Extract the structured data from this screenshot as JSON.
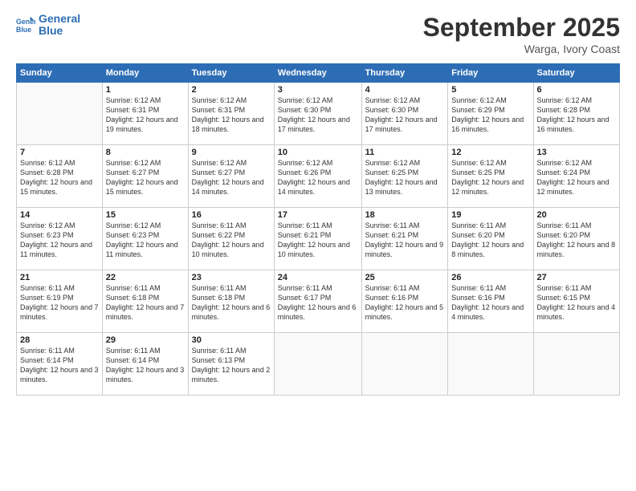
{
  "logo": {
    "line1": "General",
    "line2": "Blue"
  },
  "title": "September 2025",
  "location": "Warga, Ivory Coast",
  "days_of_week": [
    "Sunday",
    "Monday",
    "Tuesday",
    "Wednesday",
    "Thursday",
    "Friday",
    "Saturday"
  ],
  "weeks": [
    [
      {
        "day": "",
        "sunrise": "",
        "sunset": "",
        "daylight": ""
      },
      {
        "day": "1",
        "sunrise": "Sunrise: 6:12 AM",
        "sunset": "Sunset: 6:31 PM",
        "daylight": "Daylight: 12 hours and 19 minutes."
      },
      {
        "day": "2",
        "sunrise": "Sunrise: 6:12 AM",
        "sunset": "Sunset: 6:31 PM",
        "daylight": "Daylight: 12 hours and 18 minutes."
      },
      {
        "day": "3",
        "sunrise": "Sunrise: 6:12 AM",
        "sunset": "Sunset: 6:30 PM",
        "daylight": "Daylight: 12 hours and 17 minutes."
      },
      {
        "day": "4",
        "sunrise": "Sunrise: 6:12 AM",
        "sunset": "Sunset: 6:30 PM",
        "daylight": "Daylight: 12 hours and 17 minutes."
      },
      {
        "day": "5",
        "sunrise": "Sunrise: 6:12 AM",
        "sunset": "Sunset: 6:29 PM",
        "daylight": "Daylight: 12 hours and 16 minutes."
      },
      {
        "day": "6",
        "sunrise": "Sunrise: 6:12 AM",
        "sunset": "Sunset: 6:28 PM",
        "daylight": "Daylight: 12 hours and 16 minutes."
      }
    ],
    [
      {
        "day": "7",
        "sunrise": "Sunrise: 6:12 AM",
        "sunset": "Sunset: 6:28 PM",
        "daylight": "Daylight: 12 hours and 15 minutes."
      },
      {
        "day": "8",
        "sunrise": "Sunrise: 6:12 AM",
        "sunset": "Sunset: 6:27 PM",
        "daylight": "Daylight: 12 hours and 15 minutes."
      },
      {
        "day": "9",
        "sunrise": "Sunrise: 6:12 AM",
        "sunset": "Sunset: 6:27 PM",
        "daylight": "Daylight: 12 hours and 14 minutes."
      },
      {
        "day": "10",
        "sunrise": "Sunrise: 6:12 AM",
        "sunset": "Sunset: 6:26 PM",
        "daylight": "Daylight: 12 hours and 14 minutes."
      },
      {
        "day": "11",
        "sunrise": "Sunrise: 6:12 AM",
        "sunset": "Sunset: 6:25 PM",
        "daylight": "Daylight: 12 hours and 13 minutes."
      },
      {
        "day": "12",
        "sunrise": "Sunrise: 6:12 AM",
        "sunset": "Sunset: 6:25 PM",
        "daylight": "Daylight: 12 hours and 12 minutes."
      },
      {
        "day": "13",
        "sunrise": "Sunrise: 6:12 AM",
        "sunset": "Sunset: 6:24 PM",
        "daylight": "Daylight: 12 hours and 12 minutes."
      }
    ],
    [
      {
        "day": "14",
        "sunrise": "Sunrise: 6:12 AM",
        "sunset": "Sunset: 6:23 PM",
        "daylight": "Daylight: 12 hours and 11 minutes."
      },
      {
        "day": "15",
        "sunrise": "Sunrise: 6:12 AM",
        "sunset": "Sunset: 6:23 PM",
        "daylight": "Daylight: 12 hours and 11 minutes."
      },
      {
        "day": "16",
        "sunrise": "Sunrise: 6:11 AM",
        "sunset": "Sunset: 6:22 PM",
        "daylight": "Daylight: 12 hours and 10 minutes."
      },
      {
        "day": "17",
        "sunrise": "Sunrise: 6:11 AM",
        "sunset": "Sunset: 6:21 PM",
        "daylight": "Daylight: 12 hours and 10 minutes."
      },
      {
        "day": "18",
        "sunrise": "Sunrise: 6:11 AM",
        "sunset": "Sunset: 6:21 PM",
        "daylight": "Daylight: 12 hours and 9 minutes."
      },
      {
        "day": "19",
        "sunrise": "Sunrise: 6:11 AM",
        "sunset": "Sunset: 6:20 PM",
        "daylight": "Daylight: 12 hours and 8 minutes."
      },
      {
        "day": "20",
        "sunrise": "Sunrise: 6:11 AM",
        "sunset": "Sunset: 6:20 PM",
        "daylight": "Daylight: 12 hours and 8 minutes."
      }
    ],
    [
      {
        "day": "21",
        "sunrise": "Sunrise: 6:11 AM",
        "sunset": "Sunset: 6:19 PM",
        "daylight": "Daylight: 12 hours and 7 minutes."
      },
      {
        "day": "22",
        "sunrise": "Sunrise: 6:11 AM",
        "sunset": "Sunset: 6:18 PM",
        "daylight": "Daylight: 12 hours and 7 minutes."
      },
      {
        "day": "23",
        "sunrise": "Sunrise: 6:11 AM",
        "sunset": "Sunset: 6:18 PM",
        "daylight": "Daylight: 12 hours and 6 minutes."
      },
      {
        "day": "24",
        "sunrise": "Sunrise: 6:11 AM",
        "sunset": "Sunset: 6:17 PM",
        "daylight": "Daylight: 12 hours and 6 minutes."
      },
      {
        "day": "25",
        "sunrise": "Sunrise: 6:11 AM",
        "sunset": "Sunset: 6:16 PM",
        "daylight": "Daylight: 12 hours and 5 minutes."
      },
      {
        "day": "26",
        "sunrise": "Sunrise: 6:11 AM",
        "sunset": "Sunset: 6:16 PM",
        "daylight": "Daylight: 12 hours and 4 minutes."
      },
      {
        "day": "27",
        "sunrise": "Sunrise: 6:11 AM",
        "sunset": "Sunset: 6:15 PM",
        "daylight": "Daylight: 12 hours and 4 minutes."
      }
    ],
    [
      {
        "day": "28",
        "sunrise": "Sunrise: 6:11 AM",
        "sunset": "Sunset: 6:14 PM",
        "daylight": "Daylight: 12 hours and 3 minutes."
      },
      {
        "day": "29",
        "sunrise": "Sunrise: 6:11 AM",
        "sunset": "Sunset: 6:14 PM",
        "daylight": "Daylight: 12 hours and 3 minutes."
      },
      {
        "day": "30",
        "sunrise": "Sunrise: 6:11 AM",
        "sunset": "Sunset: 6:13 PM",
        "daylight": "Daylight: 12 hours and 2 minutes."
      },
      {
        "day": "",
        "sunrise": "",
        "sunset": "",
        "daylight": ""
      },
      {
        "day": "",
        "sunrise": "",
        "sunset": "",
        "daylight": ""
      },
      {
        "day": "",
        "sunrise": "",
        "sunset": "",
        "daylight": ""
      },
      {
        "day": "",
        "sunrise": "",
        "sunset": "",
        "daylight": ""
      }
    ]
  ]
}
